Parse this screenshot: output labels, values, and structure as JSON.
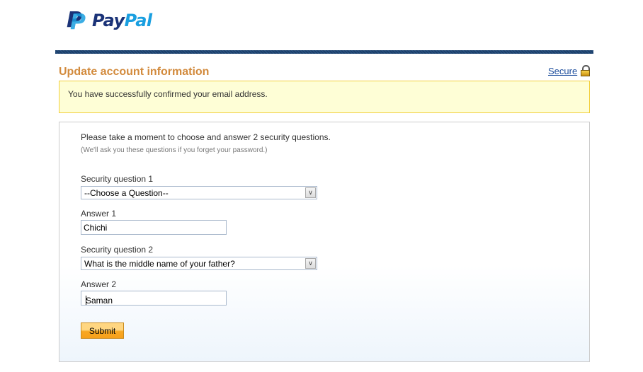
{
  "header": {
    "logo_text_pay": "Pay",
    "logo_text_pal": "Pal",
    "secure_link": "Secure",
    "lock_icon": "lock-icon"
  },
  "page_title": "Update account information",
  "notice": "You have successfully confirmed your email address.",
  "form": {
    "intro": "Please take a moment to choose and answer 2 security questions.",
    "hint": "(We'll ask you these questions if you forget your password.)",
    "q1_label": "Security question 1",
    "q1_value": "--Choose a Question--",
    "a1_label": "Answer 1",
    "a1_value": "Chichi",
    "q2_label": "Security question 2",
    "q2_value": "What is the middle name of your father?",
    "a2_label": "Answer 2",
    "a2_value": "Saman",
    "submit": "Submit"
  },
  "colors": {
    "title": "#d28a3c",
    "link": "#1a4b9b",
    "notice_bg": "#fefed6",
    "notice_border": "#f2cf3c",
    "brand_dark": "#1b3378",
    "brand_light": "#1a9fe0"
  }
}
